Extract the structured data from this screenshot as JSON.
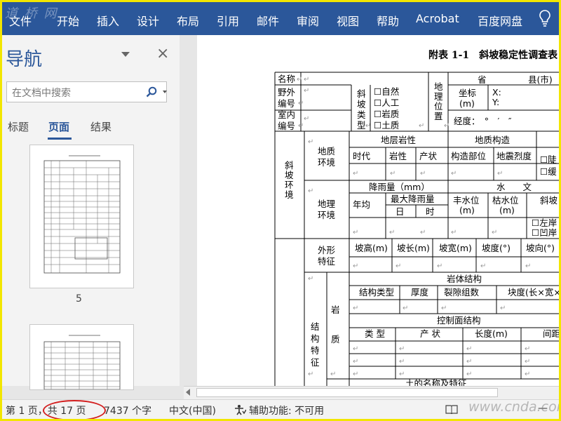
{
  "ribbon": {
    "watermark": "道 桥 网",
    "tabs": [
      "文件",
      "开始",
      "插入",
      "设计",
      "布局",
      "引用",
      "邮件",
      "审阅",
      "视图",
      "帮助",
      "Acrobat",
      "百度网盘"
    ]
  },
  "nav": {
    "title": "导航",
    "close": "×",
    "search_placeholder": "在文档中搜索",
    "tabs": [
      "标题",
      "页面",
      "结果"
    ],
    "active_tab": "页面",
    "thumb_page": "5"
  },
  "doc": {
    "title": "附表 1-1　斜坡稳定性调查表",
    "mark": "↵",
    "cells": {
      "name": "名称",
      "field_no_1": "野外",
      "field_no_2": "编号",
      "indoor_no_1": "室内",
      "indoor_no_2": "编号",
      "slope_type": "斜坡类型",
      "natural": "☐自然",
      "artificial": "☐人工",
      "rock": "☐岩质",
      "soil": "☐土质",
      "geo_loc": "地理位置",
      "province": "省",
      "county": "县(市)",
      "coord_1": "坐标",
      "coord_2": "(m)",
      "x": "X:",
      "y": "Y:",
      "longitude": "经度：　°　′　″",
      "slope_env": "斜坡环境",
      "geol_env_1": "地质",
      "geol_env_2": "环境",
      "strata": "地层岩性",
      "structure": "地质构造",
      "era": "时代",
      "lithology": "岩性",
      "attitude": "产状",
      "struct_pos": "构造部位",
      "seismic": "地震烈度",
      "steep": "☐陡",
      "gentle": "☐缓",
      "geog_env_1": "地理",
      "geog_env_2": "环境",
      "rainfall": "降雨量（mm）",
      "water": "水　　文",
      "annual": "年均",
      "max_rain": "最大降雨量",
      "day": "日",
      "hour": "时",
      "flood_1": "丰水位",
      "flood_2": "(m)",
      "dry_1": "枯水位",
      "dry_2": "(m)",
      "slope_loc_1": "斜坡",
      "slope_loc_2": "位",
      "left_bank": "☐左岸",
      "concave": "☐凹岸",
      "shape_1": "外形",
      "shape_2": "特征",
      "height": "坡高(m)",
      "length": "坡长(m)",
      "width": "坡宽(m)",
      "degree": "坡度(°)",
      "aspect": "坡向(°)",
      "struct_feat": "结构特征",
      "rock_1": "岩",
      "rock_2": "质",
      "rock_struct": "岩体结构",
      "struct_type": "结构类型",
      "thickness": "厚度",
      "fissures": "裂隙组数",
      "block": "块度(长×宽×高",
      "ctrl_plane": "控制面结构",
      "c_type": "类 型",
      "c_attitude": "产 状",
      "c_length": "长度(m)",
      "c_spacing": "间距(m",
      "bottom": "土的名称及特征"
    }
  },
  "status": {
    "page": "第 1 页，共 17 页",
    "words": "7437 个字",
    "lang": "中文(中国)",
    "access": "辅助功能: 不可用",
    "watermark": "www.cnda.com"
  }
}
